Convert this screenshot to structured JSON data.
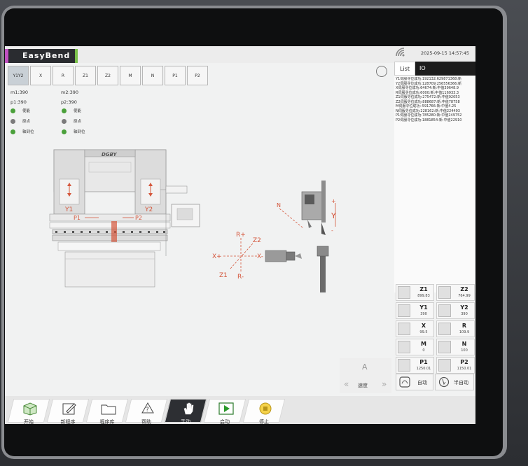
{
  "app": {
    "brand": "EasyBend",
    "datetime": "2025-09-15 14:57:45"
  },
  "axis_tabs": [
    "Y1Y2",
    "X",
    "R",
    "Z1",
    "Z2",
    "M",
    "N",
    "P1",
    "P2"
  ],
  "params": {
    "m1": "m1:390",
    "m2": "m2:390",
    "p1": "p1:390",
    "p2": "p2:390"
  },
  "status_left": [
    {
      "led": "green",
      "label": "使能"
    },
    {
      "led": "gray",
      "label": "原点"
    },
    {
      "led": "green",
      "label": "轴到位"
    }
  ],
  "status_right": [
    {
      "led": "green",
      "label": "使能"
    },
    {
      "led": "gray",
      "label": "原点"
    },
    {
      "led": "green",
      "label": "轴到位"
    }
  ],
  "diagram": {
    "y1": "Y1",
    "y2": "Y2",
    "p1": "P1",
    "p2": "P2",
    "r_plus": "R+",
    "r_minus": "R-",
    "z2": "Z2",
    "z1": "Z1",
    "x_plus": "X+",
    "x_minus": "X-",
    "y_axis": "Y",
    "n_axis": "N",
    "plus": "+",
    "minus": "-"
  },
  "right_panel": {
    "tab_list": "List",
    "tab_io": "IO",
    "log": [
      "Y1伺服寻位成功:192132:629871368:新",
      "Y2伺服寻位成功:128709:256556366:新",
      "X伺服寻位成功:64674:新:中值39648.9",
      "R伺服寻位成功:6000:新:中值116933.3",
      "Z1伺服寻位成功:275472:新:中值92053",
      "Z2伺服寻位成功:888687:新:中值78758",
      "M伺服寻位成功:-591766:新:中值4.25",
      "N伺服寻位成功:228162:新:中值224493",
      "P1伺服寻位成功:785280:新:中值249752",
      "P2伺服寻位成功:1881854:新:中值22910"
    ]
  },
  "axes_grid": [
    {
      "label": "Z1",
      "value": "899.83"
    },
    {
      "label": "Z2",
      "value": "764.99"
    },
    {
      "label": "Y1",
      "value": "390"
    },
    {
      "label": "Y2",
      "value": "390"
    },
    {
      "label": "X",
      "value": "99.5"
    },
    {
      "label": "R",
      "value": "109.9"
    },
    {
      "label": "M",
      "value": "0"
    },
    {
      "label": "N",
      "value": "100"
    },
    {
      "label": "P1",
      "value": "1250.01"
    },
    {
      "label": "P2",
      "value": "1150.01"
    }
  ],
  "mode_buttons": {
    "auto": "自动",
    "semi": "半自动"
  },
  "speed": {
    "label": "速度",
    "up": "A",
    "left": "«",
    "right": "»"
  },
  "bottom_nav": [
    {
      "label": "开始",
      "icon": "box-icon"
    },
    {
      "label": "新程序",
      "icon": "edit-icon"
    },
    {
      "label": "程序库",
      "icon": "folder-icon"
    },
    {
      "label": "帮助",
      "icon": "help-icon"
    },
    {
      "label": "手动",
      "icon": "hand-icon",
      "active": true
    },
    {
      "label": "启动",
      "icon": "play-icon"
    },
    {
      "label": "停止",
      "icon": "stop-icon"
    }
  ],
  "colors": {
    "accent_red": "#d4553a",
    "led_green": "#4aa03a",
    "brand_bar": "#2a2c30",
    "brand_pink": "#c050c0",
    "brand_green": "#7ac04a"
  }
}
